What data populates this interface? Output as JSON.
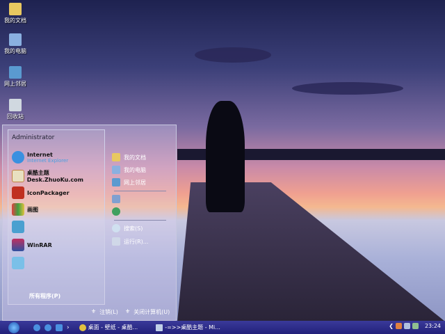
{
  "desktop_icons": [
    {
      "label": "我的文档"
    },
    {
      "label": "我的电脑"
    },
    {
      "label": "网上邻居"
    },
    {
      "label": "回收站"
    }
  ],
  "start_menu": {
    "user": "Administrator",
    "pinned": [
      {
        "label": "Internet",
        "sub": "Internet Explorer"
      },
      {
        "label": "桌酷主题Desk.ZhuoKu.com"
      },
      {
        "label": "IconPackager"
      },
      {
        "label": "画图"
      },
      {
        "label": ""
      },
      {
        "label": "WinRAR"
      },
      {
        "label": ""
      }
    ],
    "all_programs": "所有程序(P)",
    "right": [
      "我的文档",
      "我的电脑",
      "网上邻居",
      "",
      "",
      "搜索(S)",
      "运行(R)..."
    ],
    "logoff": "注销(L)",
    "shutdown": "关闭计算机(U)"
  },
  "taskbar": {
    "tasks": [
      "桌面 - 壁纸 - 桌酷...",
      "-=>>桌酷主题 - Mi..."
    ],
    "clock": "23:24"
  }
}
